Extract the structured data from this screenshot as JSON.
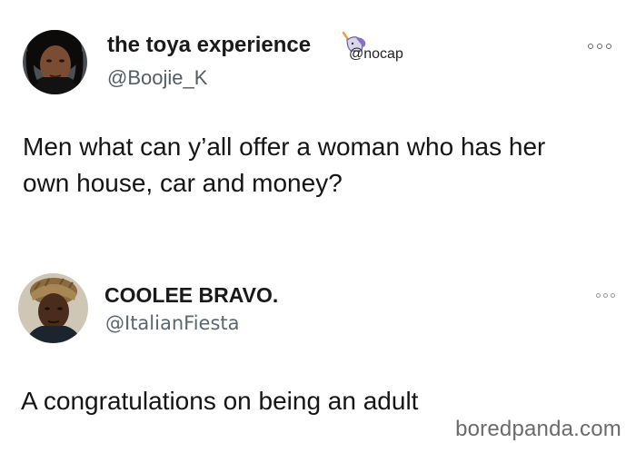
{
  "tweets": [
    {
      "display_name": "the toya experience",
      "handle": "@Boojie_K",
      "badge_label": "@nocap",
      "badge_icon": "unicorn-icon",
      "more_icon": "more-options-icon",
      "text_lines": [
        "Men what can y’all offer a woman who has her",
        "own house, car and money?"
      ]
    },
    {
      "display_name": "COOLEE BRAVO.",
      "handle": "@ItalianFiesta",
      "more_icon": "more-options-icon",
      "text_lines": [
        "A congratulations on being an adult"
      ]
    }
  ],
  "watermark": "boredpanda.com",
  "colors": {
    "text": "#0f1419",
    "handle": "#555d64",
    "background": "#ffffff",
    "watermark": "#6b6b6b"
  }
}
